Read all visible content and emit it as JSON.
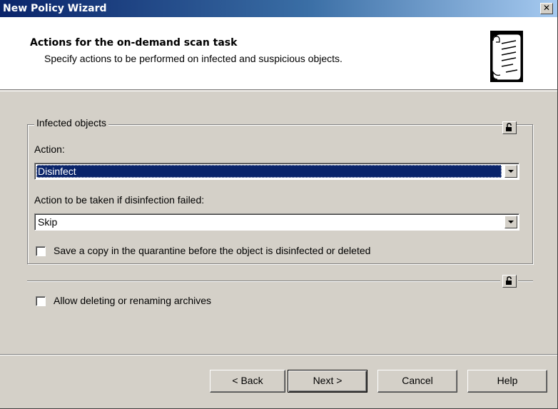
{
  "window": {
    "title": "New Policy Wizard"
  },
  "header": {
    "title": "Actions for the on-demand scan task",
    "subtitle": "Specify actions to be performed on infected and suspicious objects."
  },
  "infected": {
    "legend": "Infected objects",
    "action_label": "Action:",
    "action_value": "Disinfect",
    "failed_label": "Action to be taken if disinfection failed:",
    "failed_value": "Skip",
    "quarantine_label": "Save a copy in the quarantine before the object is disinfected or deleted",
    "quarantine_checked": false
  },
  "archives": {
    "label": "Allow deleting or renaming archives",
    "checked": false
  },
  "buttons": {
    "back": "< Back",
    "next": "Next >",
    "cancel": "Cancel",
    "help": "Help"
  },
  "icons": {
    "header": "scroll-document-icon",
    "lock": "unlocked-padlock-icon",
    "close": "close-icon"
  }
}
